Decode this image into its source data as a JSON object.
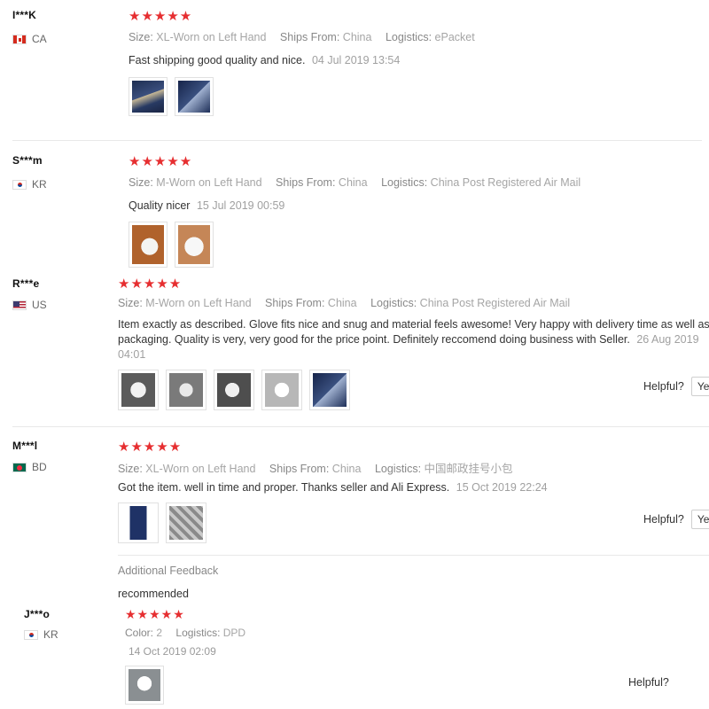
{
  "labels": {
    "size": "Size:",
    "ships_from": "Ships From:",
    "logistics": "Logistics:",
    "color": "Color:",
    "helpful": "Helpful?",
    "yes": "Ye"
  },
  "stars_text": "★★★★★",
  "reviews": [
    {
      "user": "I***K",
      "country": "CA",
      "flag": "ca-flag-icon",
      "rating": 5,
      "size": "XL-Worn on Left Hand",
      "ships_from": "China",
      "logistics": "ePacket",
      "text": "Fast shipping good quality and nice.",
      "date": "04 Jul 2019 13:54",
      "photo_count": 2
    },
    {
      "user": "S***m",
      "country": "KR",
      "flag": "kr-flag-icon",
      "rating": 5,
      "size": "M-Worn on Left Hand",
      "ships_from": "China",
      "logistics": "China Post Registered Air Mail",
      "text": "Quality nicer",
      "date": "15 Jul 2019 00:59",
      "photo_count": 2
    },
    {
      "user": "R***e",
      "country": "US",
      "flag": "us-flag-icon",
      "rating": 5,
      "size": "M-Worn on Left Hand",
      "ships_from": "China",
      "logistics": "China Post Registered Air Mail",
      "text_line1": "Item exactly as described. Glove fits nice and snug and material feels awesome! Very happy with delivery time as well as",
      "text_line2": "packaging. Quality is very, very good for the price point. Definitely reccomend doing business with Seller.",
      "date_part1": "26 Aug 2019",
      "date_part2": "04:01",
      "photo_count": 5
    },
    {
      "user": "M***l",
      "country": "BD",
      "flag": "bd-flag-icon",
      "rating": 5,
      "size": "XL-Worn on Left Hand",
      "ships_from": "China",
      "logistics": "中国邮政挂号小包",
      "text": "Got the item. well in time and proper. Thanks seller and Ali Express.",
      "date": "15 Oct 2019 22:24",
      "photo_count": 2,
      "additional_feedback_label": "Additional Feedback",
      "additional_feedback_text": "recommended"
    },
    {
      "user": "J***o",
      "country": "KR",
      "flag": "kr-flag-icon",
      "rating": 5,
      "color": "2",
      "logistics": "DPD",
      "date": "14 Oct 2019 02:09",
      "photo_count": 1
    }
  ]
}
